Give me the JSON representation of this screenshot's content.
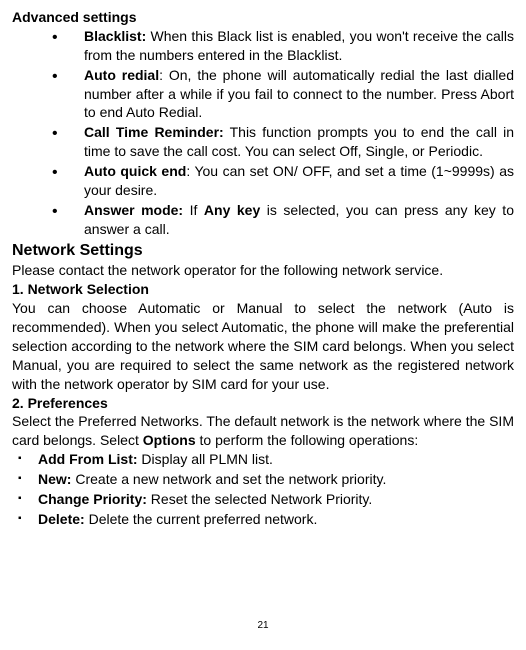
{
  "advanced_settings": {
    "title": "Advanced settings",
    "items": [
      {
        "label": "Blacklist:",
        "text": " When this Black list is enabled, you won't receive the calls from the numbers entered in the Blacklist."
      },
      {
        "label": "Auto redial",
        "text": ": On, the phone will automatically redial the last dialled number after a while if you fail to connect to the number. Press Abort to end Auto Redial."
      },
      {
        "label": "Call Time Reminder:",
        "text": " This function prompts you to end the call in time to save the call cost. You can select Off, Single, or Periodic."
      },
      {
        "label": "Auto quick end",
        "text": ": You can set ON/ OFF, and set a time (1~9999s) as your desire."
      },
      {
        "label": "Answer mode:",
        "text_pre": " If ",
        "label2": "Any key",
        "text": " is selected, you can press any key to answer a call."
      }
    ]
  },
  "network_settings": {
    "title": "Network Settings",
    "intro": "Please contact the network operator for the following network service.",
    "section1_title": "1.  Network Selection",
    "section1_text": "You can choose Automatic or Manual to select the network (Auto is recommended). When you select Automatic, the phone will make the preferential selection according to the network where the SIM card belongs. When you select Manual, you are required to select the same network as the registered network with the network operator by SIM card for your use.",
    "section2_title": "2.  Preferences",
    "section2_text_pre": "Select the Preferred Networks. The default network is the network where the SIM card belongs. Select ",
    "section2_bold": "Options",
    "section2_text_post": " to perform the following operations:",
    "options": [
      {
        "label": "Add From List:",
        "text": " Display all PLMN list."
      },
      {
        "label": "New:",
        "text": " Create a new network and set the network priority."
      },
      {
        "label": "Change Priority:",
        "text": " Reset the selected Network Priority."
      },
      {
        "label": "Delete:",
        "text": " Delete the current preferred network."
      }
    ]
  },
  "page_number": "21"
}
